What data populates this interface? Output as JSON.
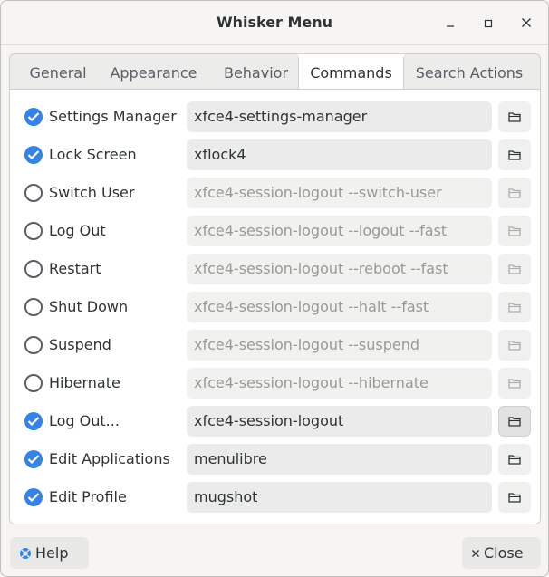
{
  "window": {
    "title": "Whisker Menu"
  },
  "tabs": [
    {
      "label": "General"
    },
    {
      "label": "Appearance"
    },
    {
      "label": "Behavior"
    },
    {
      "label": "Commands"
    },
    {
      "label": "Search Actions"
    }
  ],
  "commands": [
    {
      "label": "Settings Manager",
      "command": "xfce4-settings-manager",
      "enabled": true
    },
    {
      "label": "Lock Screen",
      "command": "xflock4",
      "enabled": true
    },
    {
      "label": "Switch User",
      "command": "xfce4-session-logout --switch-user",
      "enabled": false
    },
    {
      "label": "Log Out",
      "command": "xfce4-session-logout --logout --fast",
      "enabled": false
    },
    {
      "label": "Restart",
      "command": "xfce4-session-logout --reboot --fast",
      "enabled": false
    },
    {
      "label": "Shut Down",
      "command": "xfce4-session-logout --halt --fast",
      "enabled": false
    },
    {
      "label": "Suspend",
      "command": "xfce4-session-logout --suspend",
      "enabled": false
    },
    {
      "label": "Hibernate",
      "command": "xfce4-session-logout --hibernate",
      "enabled": false
    },
    {
      "label": "Log Out...",
      "command": "xfce4-session-logout",
      "enabled": true
    },
    {
      "label": "Edit Applications",
      "command": "menulibre",
      "enabled": true
    },
    {
      "label": "Edit Profile",
      "command": "mugshot",
      "enabled": true
    }
  ],
  "footer": {
    "help_label": "Help",
    "close_label": "Close"
  },
  "colors": {
    "accent": "#3584e4",
    "help_icon": "#3584e4"
  },
  "icons": {
    "minimize": "minimize-icon",
    "maximize": "maximize-icon",
    "close": "close-icon",
    "browse": "folder-icon",
    "help": "help-icon",
    "close_button": "close-icon"
  }
}
